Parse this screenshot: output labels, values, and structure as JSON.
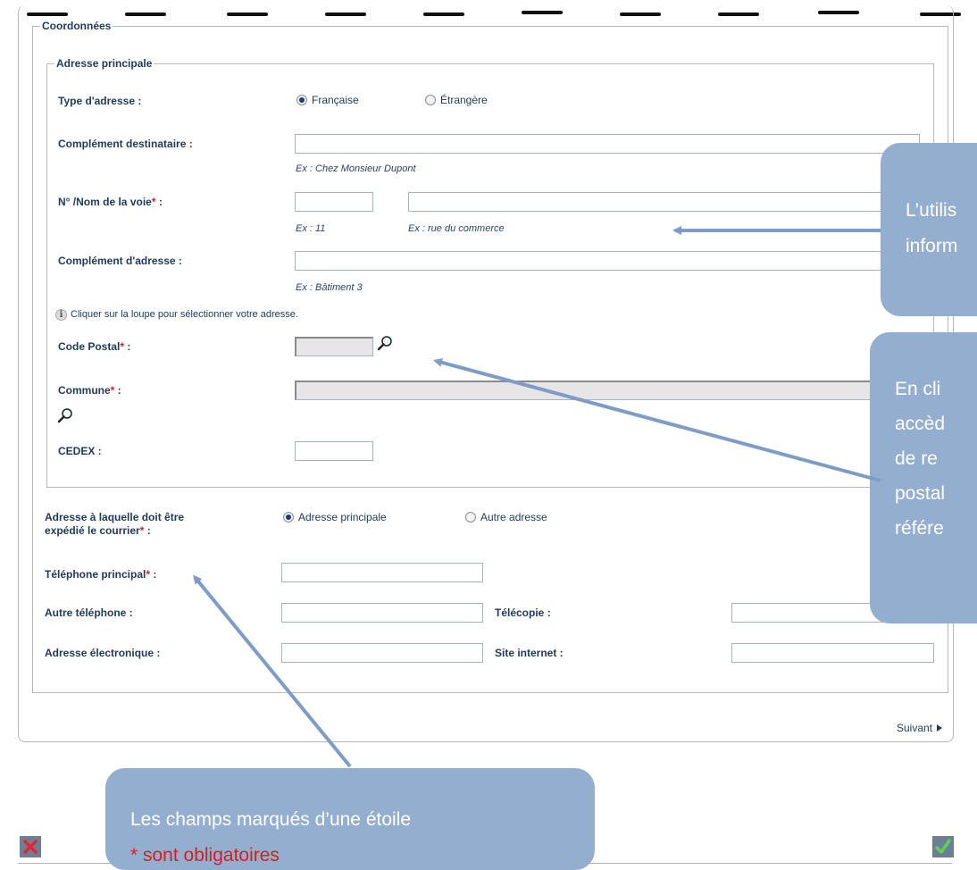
{
  "form": {
    "coordonnees_legend": "Coordonnées",
    "adresse_principale_legend": "Adresse principale",
    "type_adresse": {
      "label": "Type d'adresse :",
      "opt1": "Française",
      "opt2": "Étrangère"
    },
    "complement_destinataire": {
      "label": "Complément destinataire :",
      "hint": "Ex : Chez Monsieur Dupont"
    },
    "voie": {
      "label": "N° /Nom de la voie",
      "colon": " :",
      "hint_num": "Ex : 11",
      "hint_nom": "Ex : rue du commerce"
    },
    "complement_adresse": {
      "label": "Complément d'adresse :",
      "hint": "Ex : Bâtiment 3"
    },
    "info_loupe": "Cliquer sur la loupe pour sélectionner votre adresse.",
    "code_postal": {
      "label": "Code Postal",
      "colon": " :"
    },
    "commune": {
      "label": "Commune",
      "colon": " :"
    },
    "cedex": {
      "label": "CEDEX :"
    },
    "adresse_courrier": {
      "label1": "Adresse à laquelle doit être",
      "label2": "expédié le courrier",
      "colon": " :",
      "opt1": "Adresse principale",
      "opt2": "Autre adresse"
    },
    "telephone_principal": {
      "label": "Téléphone principal",
      "colon": " :"
    },
    "autre_telephone": {
      "label": "Autre téléphone :"
    },
    "telecopie": {
      "label": "Télécopie :"
    },
    "adresse_electronique": {
      "label": "Adresse électronique :"
    },
    "site_internet": {
      "label": "Site internet :"
    },
    "required_mark": "*",
    "suivant": "Suivant"
  },
  "callouts": {
    "top_right_line1": "L’utilis",
    "top_right_line2": "inform",
    "mid_right_lines": [
      "En  cli",
      "accèd",
      "de  re",
      "postal",
      "référe"
    ],
    "bottom_line1": "Les champs marqués d’une étoile",
    "bottom_line2": "* sont obligatoires"
  },
  "colors": {
    "callout": "#94aed0",
    "arrow": "#7e9cc6",
    "required": "#d71e1e",
    "text": "#1f3a5a"
  }
}
